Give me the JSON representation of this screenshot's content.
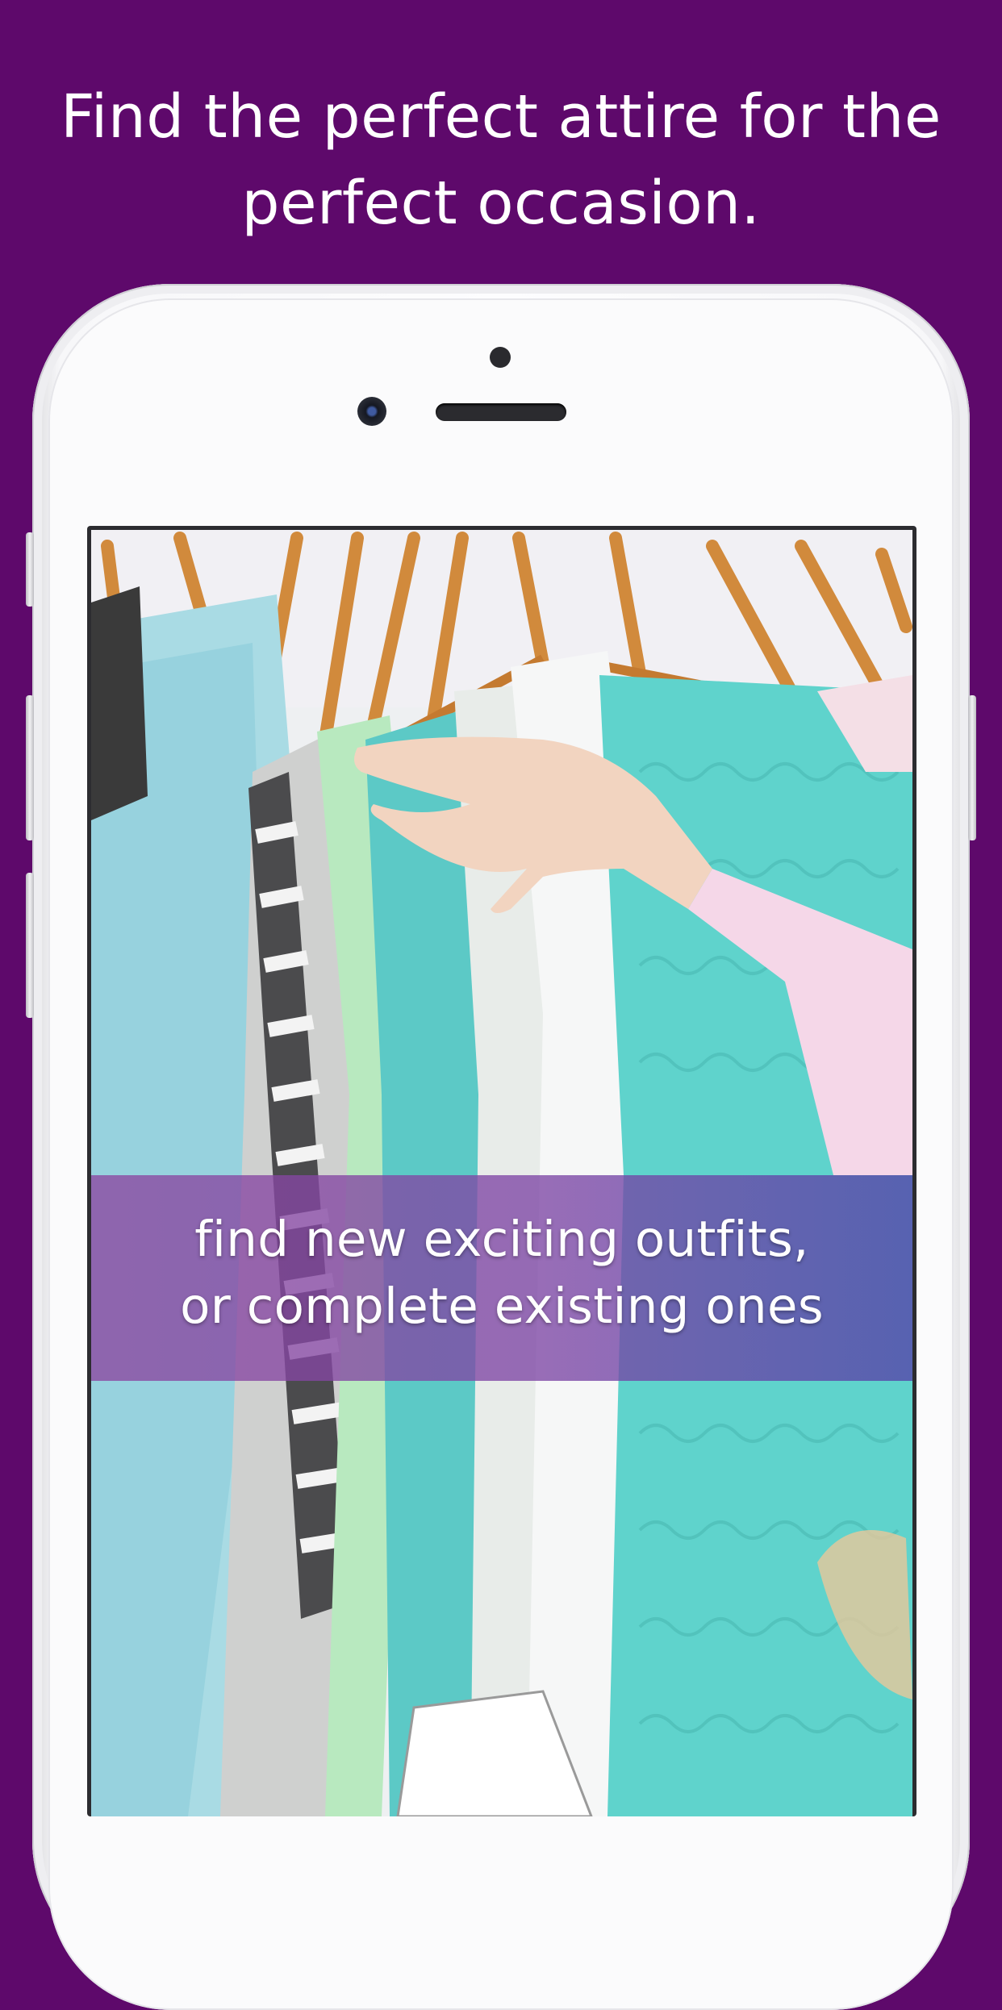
{
  "headline": {
    "line1": "Find the perfect attire for the",
    "line2": "perfect occasion."
  },
  "screen": {
    "banner_line1": "find new exciting outfits,",
    "banner_line2": "or complete existing ones"
  },
  "colors": {
    "background": "#5e096b",
    "banner_overlay": "#7d46a5",
    "text": "#ffffff"
  },
  "icons": [
    "front-camera-icon",
    "proximity-sensor-icon",
    "earpiece-speaker-icon"
  ]
}
